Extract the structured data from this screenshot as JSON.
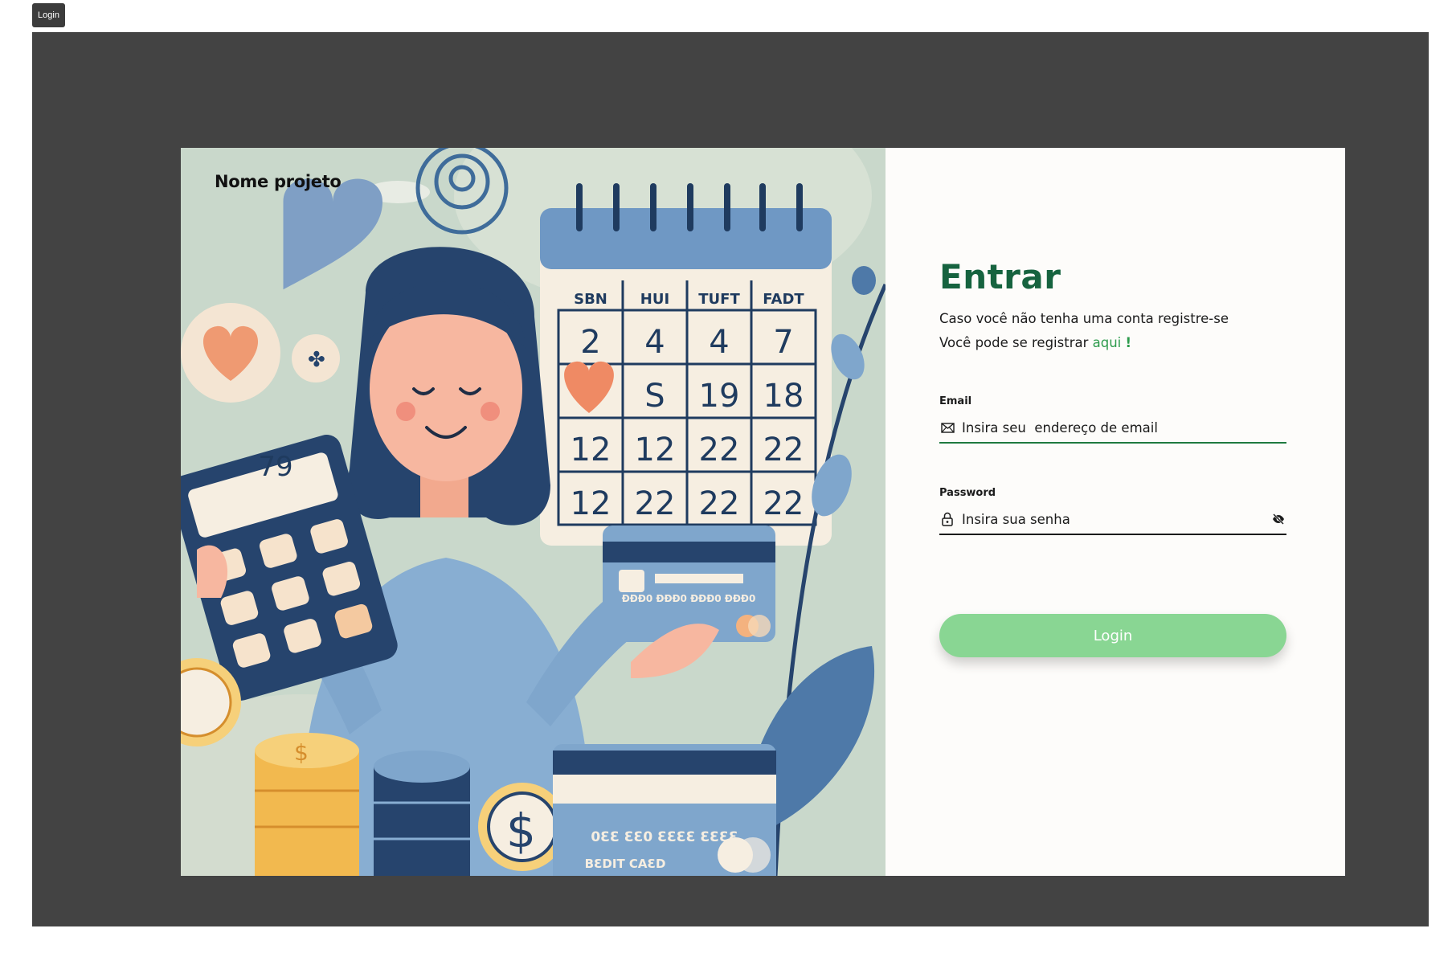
{
  "tab": {
    "label": "Login"
  },
  "brand": {
    "project_name": "Nome projeto"
  },
  "illustration": {
    "calendar_headers": [
      "SBN",
      "HUI",
      "TUFT",
      "FADT"
    ],
    "calendar_rows": [
      [
        "2",
        "4",
        "4",
        "7"
      ],
      [
        "",
        "S",
        "19",
        "18"
      ],
      [
        "12",
        "12",
        "22",
        "22"
      ],
      [
        "12",
        "22",
        "22",
        "22"
      ]
    ],
    "calculator_display": "79",
    "card_small_number": "ĐĐĐ0 ĐĐĐ0 ĐĐĐ0 ĐĐĐ0",
    "card_big_number": "0ƐƐ ƐƐ0 ƐƐƐƐ ƐƐƐƐ",
    "card_big_label": "BƐDIT CAƐD",
    "coin_symbol": "$"
  },
  "form": {
    "title": "Entrar",
    "subtitle": "Caso você não tenha uma conta registre-se",
    "register_prefix": "Você pode se registrar",
    "register_link": "aqui",
    "register_suffix": "!",
    "email_label": "Email",
    "email_placeholder": "Insira seu  endereço de email",
    "password_label": "Password",
    "password_placeholder": "Insira sua senha",
    "login_button": "Login"
  },
  "colors": {
    "frame_background": "#434343",
    "title_green": "#16633f",
    "link_green": "#2d9b4c",
    "button_green": "#89d693",
    "illustration_background": "#c9d8cb"
  }
}
